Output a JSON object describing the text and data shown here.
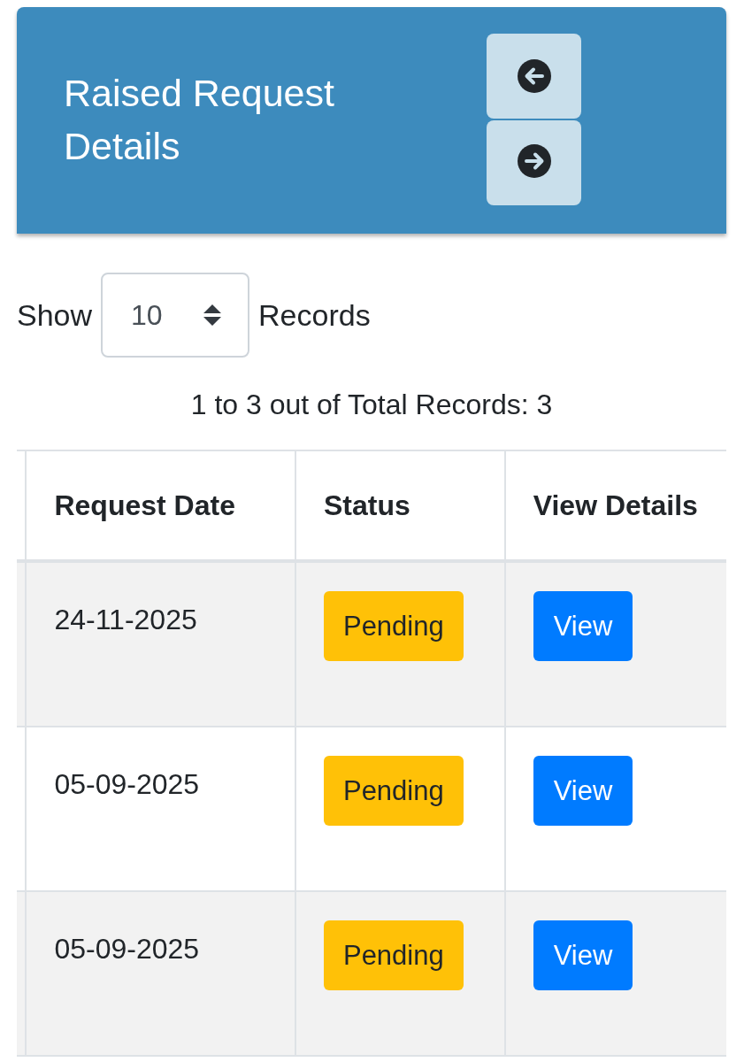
{
  "header": {
    "title": "Raised Request Details"
  },
  "records_control": {
    "prefix": "Show",
    "page_size": "10",
    "suffix": "Records"
  },
  "summary": "1 to 3 out of Total Records: 3",
  "table": {
    "columns": [
      "Request Date",
      "Status",
      "View Details"
    ],
    "rows": [
      {
        "request_date": "24-11-2025",
        "status": "Pending",
        "action": "View"
      },
      {
        "request_date": "05-09-2025",
        "status": "Pending",
        "action": "View"
      },
      {
        "request_date": "05-09-2025",
        "status": "Pending",
        "action": "View"
      }
    ]
  }
}
